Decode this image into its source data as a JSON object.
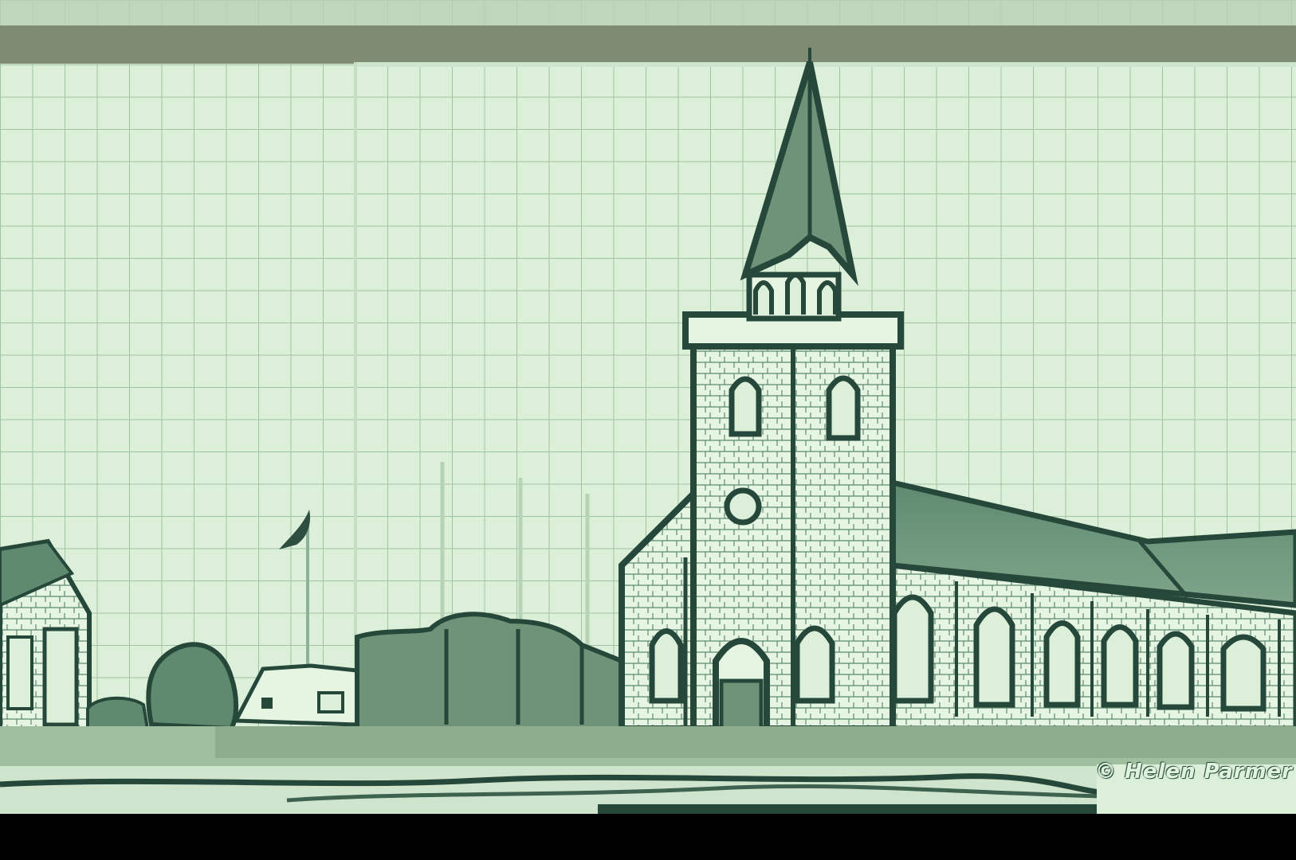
{
  "image": {
    "description_free": true,
    "palette": {
      "sky": "#dcefd8",
      "grid": "#a6c7a8",
      "ink": "#26483a",
      "band": "#7f8b73",
      "ground": "#cfe4cc",
      "shadow": "#6d9378",
      "background": "#000000"
    }
  },
  "watermark": {
    "text": "© Helen Parmer"
  }
}
